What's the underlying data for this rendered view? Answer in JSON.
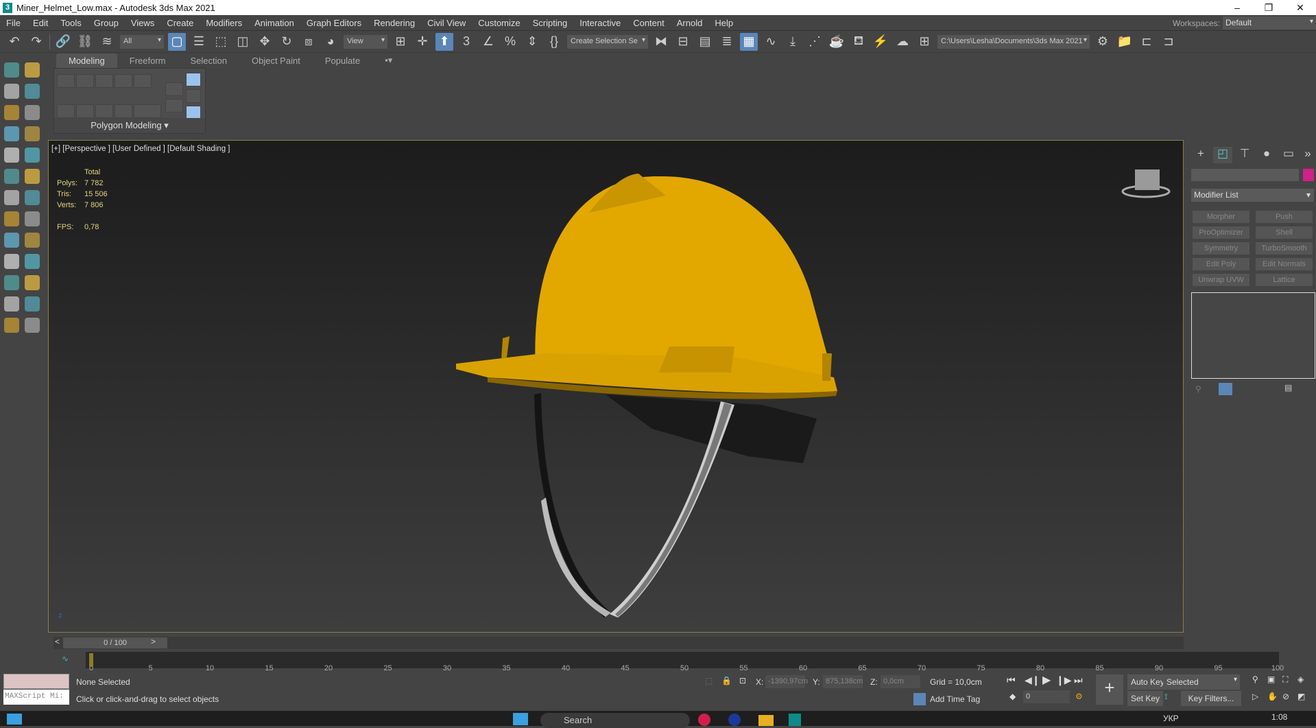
{
  "window": {
    "title": "Miner_Helmet_Low.max - Autodesk 3ds Max 2021",
    "controls": [
      "–",
      "❐",
      "✕"
    ]
  },
  "menu": [
    "File",
    "Edit",
    "Tools",
    "Group",
    "Views",
    "Create",
    "Modifiers",
    "Animation",
    "Graph Editors",
    "Rendering",
    "Civil View",
    "Customize",
    "Scripting",
    "Interactive",
    "Content",
    "Arnold",
    "Help"
  ],
  "workspace": {
    "label": "Workspaces:",
    "value": "Default"
  },
  "toolbar": {
    "filter": "All",
    "ref_coord": "View",
    "selection_set": "Create Selection Se",
    "project_path": "C:\\Users\\Lesha\\Documents\\3ds Max 2021"
  },
  "ribbon": {
    "tabs": [
      "Modeling",
      "Freeform",
      "Selection",
      "Object Paint",
      "Populate"
    ],
    "panel_label": "Polygon Modeling"
  },
  "viewport": {
    "label": "[+] [Perspective ] [User Defined ] [Default Shading ]",
    "stats": {
      "header": "Total",
      "polys_label": "Polys:",
      "polys": "7 782",
      "tris_label": "Tris:",
      "tris": "15 506",
      "verts_label": "Verts:",
      "verts": "7 806",
      "fps_label": "FPS:",
      "fps": "0,78"
    }
  },
  "command_panel": {
    "modifier_list": "Modifier List",
    "modifiers": [
      "Morpher",
      "Push",
      "ProOptimizer",
      "Shell",
      "Symmetry",
      "TurboSmooth",
      "Edit Poly",
      "Edit Normals",
      "Unwrap UVW",
      "Lattice"
    ],
    "object_color": "#d0208a"
  },
  "timeline": {
    "slider": "0 / 100",
    "prev": "<",
    "next": ">",
    "ticks": [
      "0",
      "5",
      "10",
      "15",
      "20",
      "25",
      "30",
      "35",
      "40",
      "45",
      "50",
      "55",
      "60",
      "65",
      "70",
      "75",
      "80",
      "85",
      "90",
      "95",
      "100"
    ]
  },
  "status": {
    "maxscript": "MAXScript Mi:",
    "selection": "None Selected",
    "prompt": "Click or click-and-drag to select objects",
    "x_label": "X:",
    "x": "-1390,97cm",
    "y_label": "Y:",
    "y": "875,138cm",
    "z_label": "Z:",
    "z": "0,0cm",
    "grid": "Grid = 10,0cm",
    "add_time_tag": "Add Time Tag",
    "auto_key": "Auto Key",
    "set_key": "Set Key",
    "key_mode": "Selected",
    "key_filters": "Key Filters...",
    "frame": "0"
  },
  "taskbar": {
    "search": "Search",
    "lang": "УКР",
    "time": "1:08"
  }
}
